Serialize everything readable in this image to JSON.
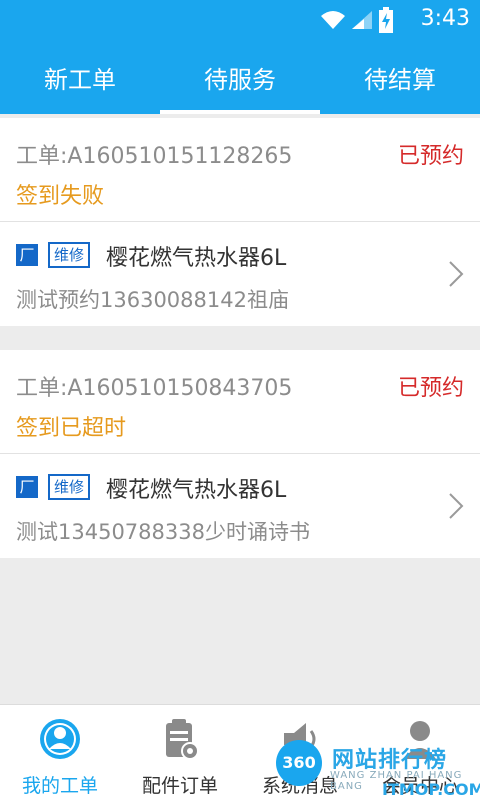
{
  "status_bar": {
    "time": "3:43"
  },
  "tabs": [
    {
      "label": "新工单",
      "active": false
    },
    {
      "label": "待服务",
      "active": true
    },
    {
      "label": "待结算",
      "active": false
    }
  ],
  "orders": [
    {
      "order_no": "工单:A160510151128265",
      "state": "已预约",
      "sign_status": "签到失败",
      "factory_badge": "厂",
      "type_badge": "维修",
      "product": "樱花燃气热水器6L",
      "desc": "测试预约13630088142祖庙"
    },
    {
      "order_no": "工单:A160510150843705",
      "state": "已预约",
      "sign_status": "签到已超时",
      "factory_badge": "厂",
      "type_badge": "维修",
      "product": "樱花燃气热水器6L",
      "desc": "测试13450788338少时诵诗书"
    }
  ],
  "bottom_nav": [
    {
      "label": "我的工单",
      "icon": "person-circle-icon",
      "active": true
    },
    {
      "label": "配件订单",
      "icon": "clipboard-gear-icon",
      "active": false
    },
    {
      "label": "系统消息",
      "icon": "speaker-icon",
      "active": false
    },
    {
      "label": "会员中心",
      "icon": "member-icon",
      "active": false
    }
  ],
  "watermark": {
    "circle": "360",
    "title": "网站排行榜",
    "sub": "WANG ZHAN PAI HANG BANG",
    "domain": "ITMOP.COM"
  },
  "colors": {
    "primary": "#1aa6ee",
    "state_red": "#d52a2a",
    "sign_orange": "#e69a1e",
    "badge_blue": "#1468c8"
  }
}
